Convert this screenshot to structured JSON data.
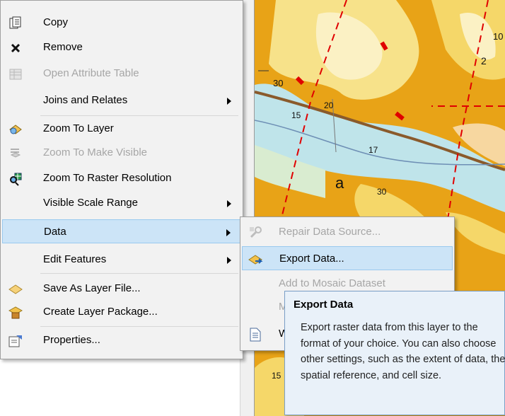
{
  "main_menu": {
    "items": [
      {
        "label": "Copy",
        "icon": "copy-icon",
        "enabled": true,
        "submenu": false
      },
      {
        "label": "Remove",
        "icon": "remove-x-icon",
        "enabled": true,
        "submenu": false
      },
      {
        "label": "Open Attribute Table",
        "icon": "table-icon",
        "enabled": false,
        "submenu": false
      },
      {
        "label": "Joins and Relates",
        "icon": "",
        "enabled": true,
        "submenu": true
      },
      {
        "label": "Zoom To Layer",
        "icon": "zoom-to-layer-icon",
        "enabled": true,
        "submenu": false
      },
      {
        "label": "Zoom To Make Visible",
        "icon": "zoom-visible-icon",
        "enabled": false,
        "submenu": false
      },
      {
        "label": "Zoom To Raster Resolution",
        "icon": "zoom-raster-icon",
        "enabled": true,
        "submenu": false
      },
      {
        "label": "Visible Scale Range",
        "icon": "",
        "enabled": true,
        "submenu": true
      },
      {
        "label": "Data",
        "icon": "",
        "enabled": true,
        "submenu": true,
        "highlighted": true
      },
      {
        "label": "Edit Features",
        "icon": "",
        "enabled": true,
        "submenu": true
      },
      {
        "label": "Save As Layer File...",
        "icon": "layer-file-icon",
        "enabled": true,
        "submenu": false
      },
      {
        "label": "Create Layer Package...",
        "icon": "layer-package-icon",
        "enabled": true,
        "submenu": false
      },
      {
        "label": "Properties...",
        "icon": "properties-icon",
        "enabled": true,
        "submenu": false
      }
    ]
  },
  "data_submenu": {
    "items": [
      {
        "label": "Repair Data Source...",
        "icon": "repair-icon",
        "enabled": false
      },
      {
        "label": "Export Data...",
        "icon": "export-data-icon",
        "enabled": true,
        "highlighted": true
      },
      {
        "label": "Add to Mosaic Dataset",
        "icon": "",
        "enabled": false
      },
      {
        "label": "M",
        "icon": "",
        "enabled": false
      },
      {
        "label": "W",
        "icon": "metadata-icon",
        "enabled": true
      }
    ]
  },
  "tooltip": {
    "title": "Export Data",
    "body": "Export raster data from this layer to the format of your choice. You can also choose other settings, such as the extent of data, the spatial reference, and cell size."
  },
  "map_labels": [
    "10",
    "2",
    "30",
    "15",
    "20",
    "17",
    "a",
    "30",
    "15"
  ],
  "colors": {
    "menu_bg": "#f2f2f2",
    "highlight": "#cce4f7",
    "highlight_border": "#99c9ef",
    "tooltip_bg": "#e9f1f9",
    "map_orange": "#e8a317",
    "map_yellow": "#f5d769",
    "map_water": "#bfe4ea"
  }
}
